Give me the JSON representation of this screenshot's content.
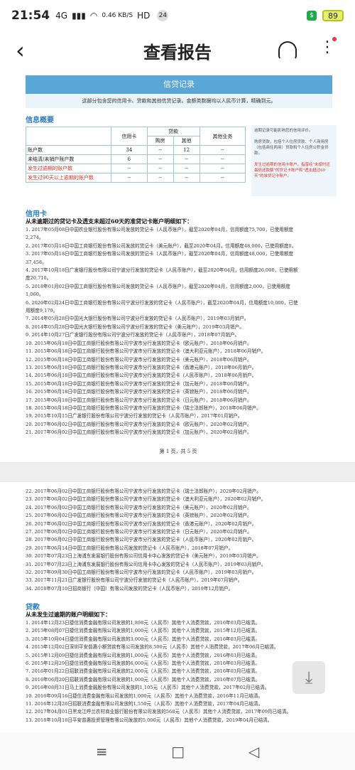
{
  "status": {
    "time": "21:54",
    "net": "4G",
    "speed": "0.46\nKB/S",
    "hd": "HD",
    "notif": "24",
    "battery": "89"
  },
  "nav": {
    "title": "查看报告",
    "back": "‹"
  },
  "report": {
    "header": "信贷记录",
    "subheader": "这部分包含您的信用卡、贷款和其他信贷记录。金额类数据均以人民币计算，精确到元。",
    "summary_title": "信息概要",
    "table": {
      "col_card": "信用卡",
      "col_loan": "贷款",
      "col_house": "购房",
      "col_other": "其他",
      "col_other_biz": "其他业务",
      "rows": [
        {
          "label": "账户数",
          "card": "34",
          "house": "--",
          "other": "12",
          "biz": "--"
        },
        {
          "label": "未结清/未销户账户数",
          "card": "6",
          "house": "--",
          "other": "--",
          "biz": "--"
        },
        {
          "label": "发生过逾期的账户数",
          "card": "--",
          "house": "--",
          "other": "--",
          "biz": "--"
        },
        {
          "label": "发生过90天以上逾期的账户数",
          "card": "--",
          "house": "--",
          "other": "--",
          "biz": "--"
        }
      ]
    },
    "note1": "逾期记录可能影响您的信用评价。",
    "note2": "购房贷款，包括个人住房贷款、个人商用房（包括商住两用）贷款和个人住房公积金贷款。",
    "note3": "发生过逾期的信用卡账户，指曾经\"未按时还最低还款额\"的贷记卡账户和\"透支超过60天\"的准贷记卡账户。",
    "card_title": "信用卡",
    "card_sub": "从未逾期过的贷记卡及透支未超过60天的准贷记卡账户明细如下：",
    "card_lines": [
      "1. 2017年05月08日中国农业银行股份有限公司发放的贷记卡（人民币账户），截至2020年04月，信用额度75,700，已使用额度",
      "2,274。",
      "2. 2017年05月18日中国工商银行股份有限公司发放的贷记卡（美元账户），截至2020年04月，信用额度48,000，已使用额度0。",
      "3. 2017年05月18日中国工商银行股份有限公司发放的贷记卡（人民币账户），截至2020年04月，信用额度48,000，已使用额度",
      "37,458。",
      "4. 2017年10月18日广发银行股份有限公司宁波分行发放的贷记卡（人民币账户），截至2020年04月，信用额度26,000，已使用额",
      "度20,710。",
      "5. 2018年01月02日中国工商银行股份有限公司发放的贷记卡（人民币账户），截至2020年04月，信用额度2,000，已使用额度",
      "1,060。",
      "6. 2020年02月24日中国工商银行股份有限公司宁波分行发放的贷记卡（人民币账户），截至2020年04月，信用额度10,000，已使",
      "用额度9,179。",
      "7. 2014年05月28日中国光大银行股份有限公司宁波分行发放的贷记卡（人民币账户），2019年03月销户。",
      "8. 2014年05月28日中国光大银行股份有限公司宁波分行发放的贷记卡（美元账户），2019年03月销户。",
      "9. 2014年10月27日广发银行股份有限公司宁波分行发放的贷记卡（人民币账户），2018年07月销户。",
      "10. 2015年06月18日中国工商银行股份有限公司宁波市分行发放的贷记卡（欧元账户），2018年06月销户。",
      "11. 2015年06月18日中国工商银行股份有限公司宁波市分行发放的贷记卡（澳大利亚元账户），2018年06月销户。",
      "12. 2015年06月18日中国工商银行股份有限公司宁波市分行发放的贷记卡（美元账户），2018年06月销户。",
      "13. 2015年06月18日中国工商银行股份有限公司宁波市分行发放的贷记卡（香港元账户），2018年06月销户。",
      "14. 2015年06月18日中国工商银行股份有限公司宁波市分行发放的贷记卡（人民币账户），2018年06月销户。",
      "15. 2015年06月18日中国工商银行股份有限公司宁波市分行发放的贷记卡（加元账户），2018年06月销户。",
      "16. 2015年06月18日中国工商银行股份有限公司宁波市分行发放的贷记卡（英镑账户），2018年06月销户。",
      "17. 2015年06月18日中国工商银行股份有限公司宁波市分行发放的贷记卡（日元账户），2018年06月销户。",
      "18. 2015年06月18日中国工商银行股份有限公司宁波市分行发放的贷记卡（瑞士法郎账户），2018年06月销户。",
      "19. 2015年10月15日广发银行股份有限公司宁波分行发放的贷记卡（人民币账户），2017年01月销户。",
      "20. 2017年06月02日中国工商银行股份有限公司宁波市分行发放的贷记卡（欧元账户），2020年02月销户。",
      "21. 2017年06月02日中国工商银行股份有限公司宁波市分行发放的贷记卡（加元账户），2020年02月销户。"
    ],
    "page_num": "第 1 页，共 5 页",
    "card_lines2": [
      "22. 2017年06月02日中国工商银行股份有限公司宁波市分行发放的贷记卡（瑞士法郎账户），2020年02月销户。",
      "23. 2017年06月02日中国工商银行股份有限公司宁波市分行发放的贷记卡（澳大利亚元账户），2020年02月销户。",
      "24. 2017年06月02日中国工商银行股份有限公司宁波市分行发放的贷记卡（美元账户），2020年02月销户。",
      "25. 2017年06月02日中国工商银行股份有限公司宁波市分行发放的贷记卡（英镑账户），2020年02月销户。",
      "26. 2017年06月02日中国工商银行股份有限公司宁波市分行发放的贷记卡（香港元账户），2020年02月销户。",
      "27. 2017年06月02日中国工商银行股份有限公司宁波市分行发放的贷记卡（日元账户），2020年02月销户。",
      "28. 2017年06月02日中国工商银行股份有限公司宁波市分行发放的贷记卡（人民币账户），2020年02月销户。",
      "29. 2017年06月14日中国工商银行股份有限公司发放的贷记卡（人民币账户），2018年07月销户。",
      "30. 2017年07月23日上海浦东发展银行股份有限公司信用卡中心发放的贷记卡（美元账户），2019年03月销户。",
      "31. 2017年07月23日上海浦东发展银行股份有限公司信用卡中心发放的贷记卡（人民币账户），2019年03月销户。",
      "32. 2017年09月30日中国工商银行股份有限公司宁波市分行发放的贷记卡（人民币账户），2019年03月销户。",
      "33. 2017年11月21日广发银行股份有限公司宁波分行发放的贷记卡（人民币账户），2019年07月销户。",
      "34. 2018年07月10日招商银行（中国）有限公司发放的贷记卡（人民币账户），2019年12月销户。"
    ],
    "loan_title": "贷款",
    "loan_sub": "从未发生过逾期的账户明细如下：",
    "loan_lines": [
      "1. 2014年12月23日捷信消费金融有限公司发放的1,898元（人民币）其他个人消费贷款，2016年03月已结清。",
      "2. 2015年08月07日捷信消费金融有限公司发放的1,000元（人民币）其他个人消费贷款，2015年12月已结清。",
      "3. 2015年10月04日捷信消费金融有限公司发放的3,000元（人民币）其他个人消费贷款，2016年03月已结清。",
      "4. 2015年12月02日深圳平安普惠小额贷款有限公司发放的8,500元（人民币）其他个人消费贷款，2017年06月已结清。",
      "5. 2015年12月09日捷信消费金融有限公司发放的1,000元（人民币）其他个人消费贷款，2016年03月已结清。",
      "6. 2015年12月29日捷信消费金融有限公司发放的6,000元（人民币）其他个人消费贷款，2016年03月已结清。",
      "7. 2016年01月22日招联消费金融有限公司发放的2,000元（人民币）其他个人消费贷款，2016年03月已结清。",
      "8. 2016年06月20日招联消费金融有限公司发放的1,000元（人民币）其他个人消费贷款，2016年07月已结清。",
      "9. 2016年08月31日马上消费金融股份有限公司发放的1,105元（人民币）其他个人消费贷款，2017年02月已结清。",
      "10. 2016年09月16日捷信消费金融有限公司发放的1,000元（人民币）其他个人消费贷款，2016年11月已结清。",
      "11. 2016年12月26日招联消费金融有限公司发放的1,550元（人民币）其他个人消费贷款，2017年04月已结清。",
      "12. 2017年04月01日黑龙江呼兰农村商业银行股份有限公司发放的568元（人民币）其他个人消费贷款，2017年09月已结清。",
      "13. 2018年10月18日平安普惠投资管理有限公司发放的5,000元（人民币）其他个人消费贷款，2019年04月已结清。"
    ]
  }
}
